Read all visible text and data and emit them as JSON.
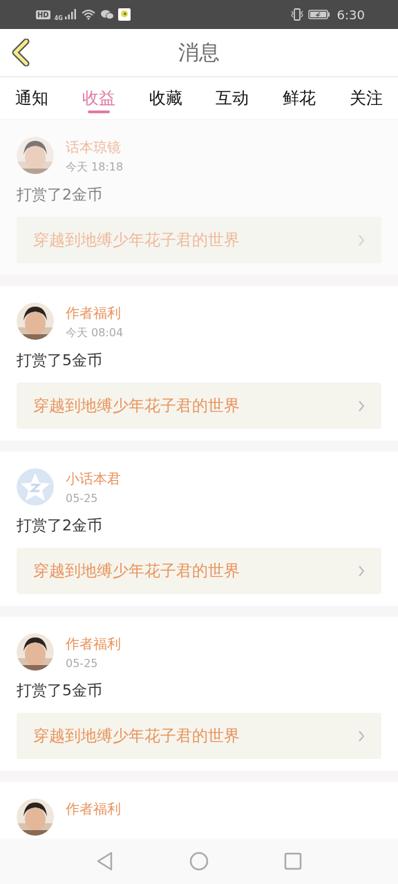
{
  "status_bar": {
    "hd": "HD",
    "network": "4G",
    "time": "6:30"
  },
  "header": {
    "title": "消息"
  },
  "tabs": [
    {
      "label": "通知",
      "selected": false
    },
    {
      "label": "收益",
      "selected": true
    },
    {
      "label": "收藏",
      "selected": false
    },
    {
      "label": "互动",
      "selected": false
    },
    {
      "label": "鲜花",
      "selected": false
    },
    {
      "label": "关注",
      "selected": false
    }
  ],
  "messages": [
    {
      "sender": "话本琼镜",
      "time": "今天 18:18",
      "text": "打赏了2金币",
      "book": "穿越到地缚少年花子君的世界",
      "faded": true
    },
    {
      "sender": "作者福利",
      "time": "今天 08:04",
      "text": "打赏了5金币",
      "book": "穿越到地缚少年花子君的世界",
      "faded": false
    },
    {
      "sender": "小话本君",
      "avatar": {
        "kind": "logo"
      },
      "time": "05-25",
      "text": "打赏了2金币",
      "book": "穿越到地缚少年花子君的世界",
      "faded": false
    },
    {
      "sender": "作者福利",
      "time": "05-25",
      "text": "打赏了5金币",
      "book": "穿越到地缚少年花子君的世界",
      "faded": false
    },
    {
      "sender": "作者福利",
      "faded": false
    }
  ]
}
